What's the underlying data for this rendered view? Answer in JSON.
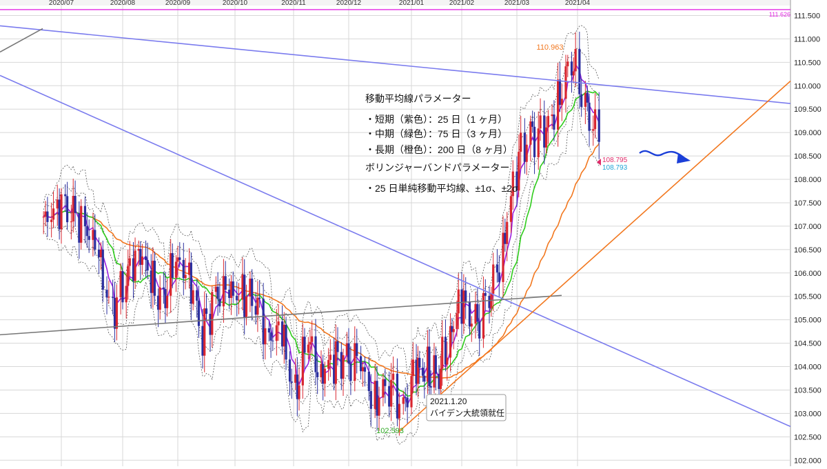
{
  "chart_data": {
    "type": "candlestick",
    "title": "",
    "x_ticks": [
      "2020/07",
      "2020/08",
      "2020/09",
      "2020/10",
      "2020/11",
      "2020/12",
      "2021/01",
      "2021/02",
      "2021/03",
      "2021/04"
    ],
    "y_ticks": [
      "111.500",
      "111.000",
      "110.500",
      "110.000",
      "109.500",
      "109.000",
      "108.500",
      "108.000",
      "107.500",
      "107.000",
      "106.500",
      "106.000",
      "105.500",
      "105.000",
      "104.500",
      "104.000",
      "103.500",
      "103.000",
      "102.500",
      "102.000"
    ],
    "ylim": [
      102.0,
      111.6
    ],
    "grid": true,
    "colors": {
      "up": "#d9262f",
      "down": "#2b2f9f",
      "ma_short": "#9a1fe0",
      "ma_mid": "#2ecc1b",
      "ma_long": "#f2771e",
      "bollinger": "#555555",
      "trend_blue": "#7a7bee",
      "trend_orange": "#f2771e",
      "trend_gray": "#777777",
      "hline_magenta": "#e326e3",
      "arrow": "#1b3fd8"
    },
    "hline_value": 111.626,
    "markers": {
      "high": {
        "value": "110.963",
        "date": "2021/03/31"
      },
      "low": {
        "value": "102.593",
        "date": "2021/01/06"
      },
      "last_red": "108.795",
      "last_cyan": "108.793"
    },
    "panel": {
      "lines": [
        "移動平均線パラメーター",
        "・短期（紫色）：25 日（1 ヶ月）",
        "・中期（緑色）：75 日（3 ヶ月）",
        "・長期（橙色）：200 日（8 ヶ月）",
        "ボリンジャーバンドパラメーター",
        "・25 日単純移動平均線、±1σ、±2σ"
      ]
    },
    "callout": {
      "date": "2021.1.20",
      "text": "バイデン大統領就任"
    },
    "price_series": [
      {
        "date": "2020-06-22",
        "close": 107.0
      },
      {
        "date": "2020-06-29",
        "close": 107.5
      },
      {
        "date": "2020-07-06",
        "close": 107.3
      },
      {
        "date": "2020-07-13",
        "close": 107.1
      },
      {
        "date": "2020-07-20",
        "close": 106.3
      },
      {
        "date": "2020-07-27",
        "close": 105.2
      },
      {
        "date": "2020-08-03",
        "close": 105.8
      },
      {
        "date": "2020-08-10",
        "close": 106.6
      },
      {
        "date": "2020-08-17",
        "close": 105.8
      },
      {
        "date": "2020-08-24",
        "close": 105.4
      },
      {
        "date": "2020-08-31",
        "close": 106.2
      },
      {
        "date": "2020-09-07",
        "close": 106.1
      },
      {
        "date": "2020-09-14",
        "close": 104.6
      },
      {
        "date": "2020-09-21",
        "close": 105.6
      },
      {
        "date": "2020-09-28",
        "close": 105.5
      },
      {
        "date": "2020-10-05",
        "close": 105.6
      },
      {
        "date": "2020-10-12",
        "close": 105.4
      },
      {
        "date": "2020-10-19",
        "close": 104.7
      },
      {
        "date": "2020-10-26",
        "close": 104.7
      },
      {
        "date": "2020-11-02",
        "close": 103.4
      },
      {
        "date": "2020-11-09",
        "close": 104.6
      },
      {
        "date": "2020-11-16",
        "close": 103.9
      },
      {
        "date": "2020-11-23",
        "close": 104.1
      },
      {
        "date": "2020-11-30",
        "close": 104.2
      },
      {
        "date": "2020-12-07",
        "close": 104.0
      },
      {
        "date": "2020-12-14",
        "close": 103.3
      },
      {
        "date": "2020-12-21",
        "close": 103.6
      },
      {
        "date": "2020-12-28",
        "close": 103.2
      },
      {
        "date": "2021-01-04",
        "close": 103.9
      },
      {
        "date": "2021-01-11",
        "close": 103.9
      },
      {
        "date": "2021-01-18",
        "close": 103.8
      },
      {
        "date": "2021-01-25",
        "close": 104.7
      },
      {
        "date": "2021-02-01",
        "close": 105.4
      },
      {
        "date": "2021-02-08",
        "close": 104.9
      },
      {
        "date": "2021-02-15",
        "close": 105.4
      },
      {
        "date": "2021-02-22",
        "close": 106.5
      },
      {
        "date": "2021-03-01",
        "close": 108.3
      },
      {
        "date": "2021-03-08",
        "close": 109.0
      },
      {
        "date": "2021-03-15",
        "close": 108.9
      },
      {
        "date": "2021-03-22",
        "close": 109.6
      },
      {
        "date": "2021-03-29",
        "close": 110.6
      },
      {
        "date": "2021-04-05",
        "close": 109.7
      },
      {
        "date": "2021-04-12",
        "close": 108.8
      }
    ]
  }
}
